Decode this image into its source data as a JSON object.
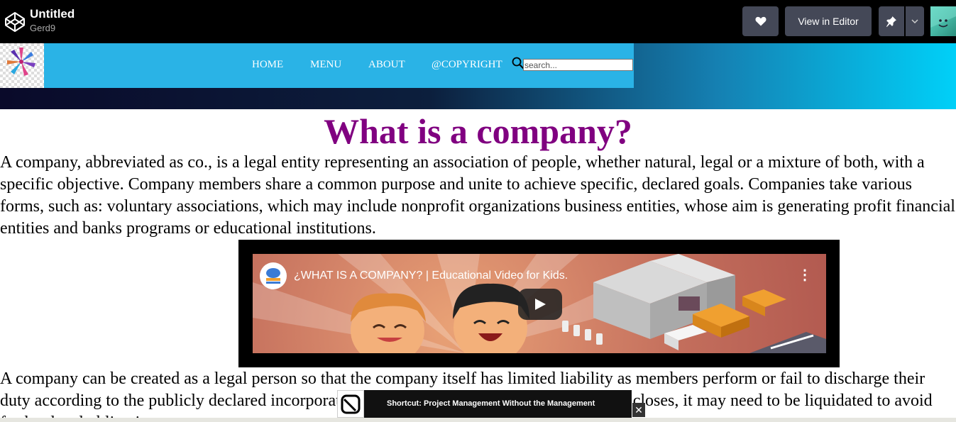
{
  "codepen": {
    "title": "Untitled",
    "user": "Gerd9",
    "view_in_editor": "View in Editor",
    "icons": [
      "codepen-icon",
      "heart-icon",
      "pin-icon",
      "chevron-down-icon",
      "avatar"
    ]
  },
  "site": {
    "nav": [
      "HOME",
      "MENU",
      "ABOUT",
      "@COPYRIGHT"
    ],
    "search_placeholder": "search..."
  },
  "content": {
    "title": "What is a company?",
    "paragraph1": "A company, abbreviated as co., is a legal entity representing an association of people, whether natural, legal or a mixture of both, with a specific objective. Company members share a common purpose and unite to achieve specific, declared goals. Companies take various forms, such as: voluntary associations, which may include nonprofit organizations business entities, whose aim is generating profit financial entities and banks programs or educational institutions.",
    "paragraph2": "A company can be created as a legal person so that the company itself has limited liability as members perform or fail to discharge their duty according to the publicly declared incorporation, or published policy. When a company closes, it may need to be liquidated to avoid further legal obligations."
  },
  "video": {
    "title": "¿WHAT IS A COMPANY? | Educational Video for Kids.",
    "menu_glyph": "⋮"
  },
  "toast": {
    "text": "Shortcut: Project Management Without the Management",
    "close_glyph": "✕"
  },
  "colors": {
    "title_purple": "#800080",
    "nav_blue": "#2ab3e6",
    "codepen_button": "#444857"
  }
}
